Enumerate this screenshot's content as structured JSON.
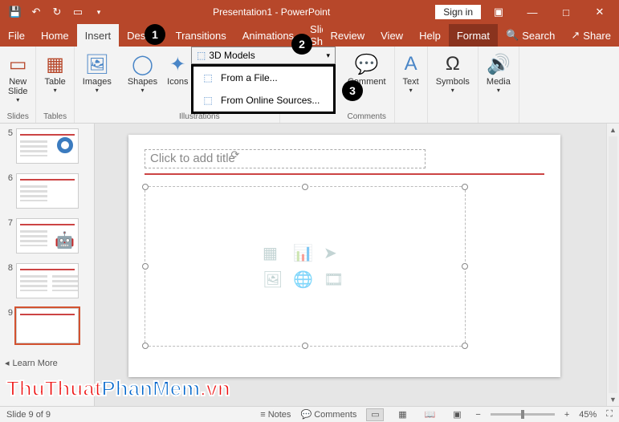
{
  "app_title": "Presentation1 - PowerPoint",
  "signin": "Sign in",
  "tabs": {
    "file": "File",
    "home": "Home",
    "insert": "Insert",
    "design": "Design",
    "transitions": "Transitions",
    "animations": "Animations",
    "slideshow": "Slide Show",
    "review": "Review",
    "view": "View",
    "help": "Help",
    "format": "Format",
    "search": "Search",
    "share": "Share"
  },
  "ribbon": {
    "slides": {
      "new_slide": "New\nSlide",
      "group": "Slides"
    },
    "tables": {
      "table": "Table",
      "group": "Tables"
    },
    "images": {
      "images": "Images"
    },
    "illustrations": {
      "shapes": "Shapes",
      "icons": "Icons",
      "three_d": "3D Models",
      "group": "Illustrations"
    },
    "comments": {
      "comment": "Comment",
      "group": "Comments"
    },
    "text": {
      "text": "Text"
    },
    "symbols": {
      "symbols": "Symbols"
    },
    "media": {
      "media": "Media"
    }
  },
  "dropdown": {
    "from_file": "From a File...",
    "from_online": "From Online Sources..."
  },
  "annotations": {
    "one": "1",
    "two": "2",
    "three": "3"
  },
  "thumbs": [
    "5",
    "6",
    "7",
    "8",
    "9"
  ],
  "learn_more": "Learn More",
  "slide": {
    "title_placeholder": "Click to add title"
  },
  "status": {
    "slide_count": "Slide 9 of 9",
    "notes": "Notes",
    "comments": "Comments",
    "zoom": "45%"
  },
  "watermark": {
    "a": "ThuThuat",
    "b": "PhanMem",
    "c": ".vn"
  }
}
